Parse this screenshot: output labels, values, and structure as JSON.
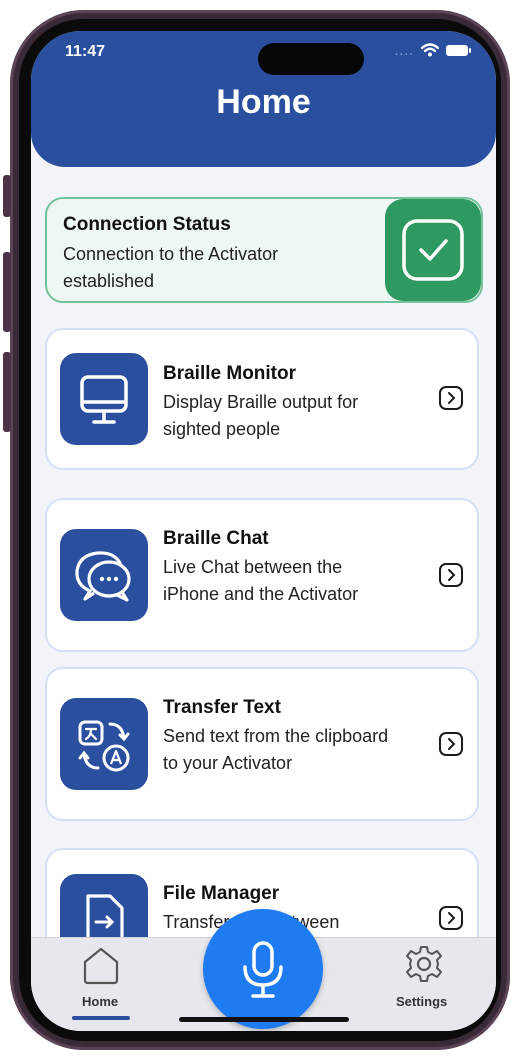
{
  "status_bar": {
    "time": "11:47",
    "signal": "...."
  },
  "header": {
    "title": "Home"
  },
  "connection": {
    "title": "Connection Status",
    "description": "Connection to the Activator established",
    "icon": "checkmark-icon",
    "color": "#2e9a62"
  },
  "features": [
    {
      "title": "Braille Monitor",
      "description": "Display Braille output for sighted people",
      "icon": "monitor-icon"
    },
    {
      "title": "Braille Chat",
      "description": "Live Chat between the iPhone and the Activator",
      "icon": "chat-bubbles-icon"
    },
    {
      "title": "Transfer Text",
      "description": "Send text from the clipboard to your Activator",
      "icon": "translate-icon"
    },
    {
      "title": "File Manager",
      "description": "Transfer files between",
      "icon": "file-transfer-icon"
    }
  ],
  "tab_bar": {
    "home_label": "Home",
    "settings_label": "Settings",
    "mic_icon": "microphone-icon"
  },
  "colors": {
    "brand": "#2b4f9f",
    "mic": "#1f7bf2",
    "success": "#2e9a62"
  }
}
